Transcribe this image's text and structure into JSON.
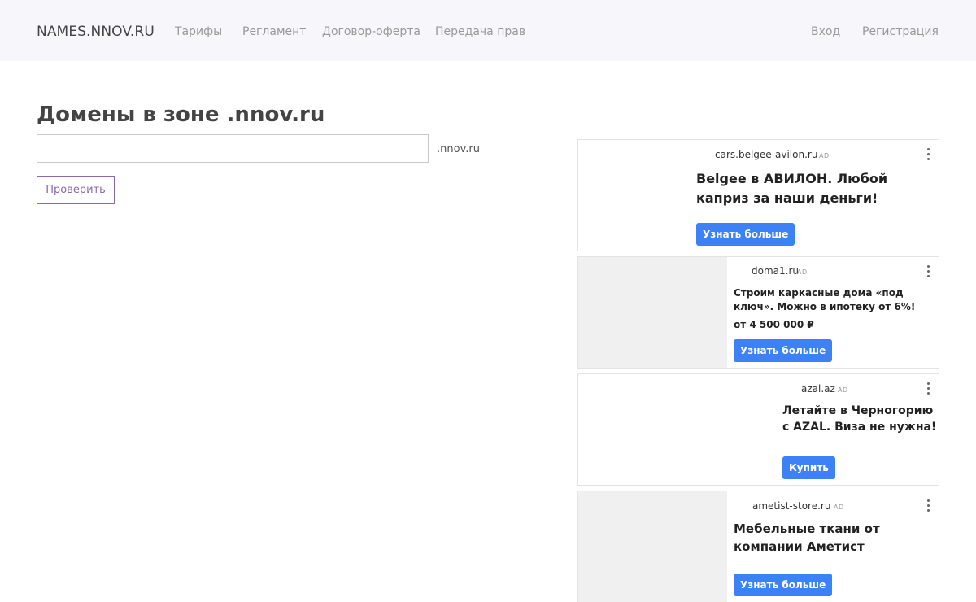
{
  "header": {
    "brand": "NAMES.NNOV.RU",
    "nav": [
      "Тарифы",
      "Регламент",
      "Договор-оферта",
      "Передача прав"
    ],
    "login": "Вход",
    "register": "Регистрация"
  },
  "main": {
    "title": "Домены в зоне .nnov.ru",
    "domain_input_value": "",
    "zone_suffix": ".nnov.ru",
    "check_button": "Проверить"
  },
  "ads": [
    {
      "domain": "cars.belgee-avilon.ru",
      "badge": "AD",
      "title": "Belgee в АВИЛОН. Любой каприз за наши деньги!",
      "cta": "Узнать больше"
    },
    {
      "domain": "doma1.ru",
      "badge": "AD",
      "title": "Строим каркасные дома «под ключ». Можно в ипотеку от 6%!",
      "price": "от 4 500 000 ₽",
      "cta": "Узнать больше"
    },
    {
      "domain": "azal.az",
      "badge": "AD",
      "title": "Летайте в Черногорию с AZAL. Виза не нужна!",
      "cta": "Купить"
    },
    {
      "domain": "ametist-store.ru",
      "badge": "AD",
      "title": "Мебельные ткани от компании Аметист",
      "cta": "Узнать больше"
    }
  ],
  "colors": {
    "header_bg": "#f7f7fb",
    "accent_purple": "#8a6aa8",
    "cta_blue": "#3c81f6"
  }
}
